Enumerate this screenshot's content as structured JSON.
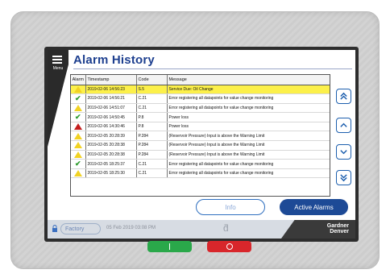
{
  "header": {
    "title": "Alarm History",
    "menu_label": "Menu"
  },
  "table": {
    "columns": [
      "Alarm",
      "Timestamp",
      "Code",
      "Message"
    ],
    "rows": [
      {
        "icon": "warning",
        "timestamp": "2019-02-06 14:56:23",
        "code": "S.5",
        "message": "Service Due: Oil Change",
        "selected": true
      },
      {
        "icon": "check",
        "timestamp": "2019-02-06 14:56:21",
        "code": "C.21",
        "message": "Error registering all datapoints for value change monitoring",
        "selected": false
      },
      {
        "icon": "warning",
        "timestamp": "2019-02-06 14:51:07",
        "code": "C.21",
        "message": "Error registering all datapoints for value change monitoring",
        "selected": false
      },
      {
        "icon": "check",
        "timestamp": "2019-02-06 14:50:45",
        "code": "P.8",
        "message": "Power loss",
        "selected": false
      },
      {
        "icon": "error",
        "timestamp": "2019-02-06 14:30:46",
        "code": "P.8",
        "message": "Power loss",
        "selected": false
      },
      {
        "icon": "warning",
        "timestamp": "2019-02-05 20:28:39",
        "code": "P.284",
        "message": "(Reservoir Pressure) Input is above the Warning Limit",
        "selected": false
      },
      {
        "icon": "warning",
        "timestamp": "2019-02-05 20:28:38",
        "code": "P.284",
        "message": "(Reservoir Pressure) Input is above the Warning Limit",
        "selected": false
      },
      {
        "icon": "warning",
        "timestamp": "2019-02-05 20:28:38",
        "code": "P.284",
        "message": "(Reservoir Pressure) Input is above the Warning Limit",
        "selected": false
      },
      {
        "icon": "check",
        "timestamp": "2019-02-05 18:25:37",
        "code": "C.21",
        "message": "Error registering all datapoints for value change monitoring",
        "selected": false
      },
      {
        "icon": "warning",
        "timestamp": "2019-02-05 18:25:30",
        "code": "C.21",
        "message": "Error registering all datapoints for value change monitoring",
        "selected": false
      }
    ]
  },
  "buttons": {
    "info": "Info",
    "active_alarms": "Active Alarms"
  },
  "statusbar": {
    "user": "Factory",
    "datetime": "05 Feb 2019 03:08 PM",
    "brand_line1": "Gardner",
    "brand_line2": "Denver"
  },
  "icons": {
    "scroll": [
      "double-chevron-up-icon",
      "chevron-up-icon",
      "chevron-down-icon",
      "double-chevron-down-icon"
    ],
    "lock": "lock-icon"
  },
  "colors": {
    "title": "#1d3f8f",
    "selected_row": "#fcf04a",
    "accent": "#1d4a96",
    "start": "#2aa84a",
    "stop": "#d8262b"
  }
}
